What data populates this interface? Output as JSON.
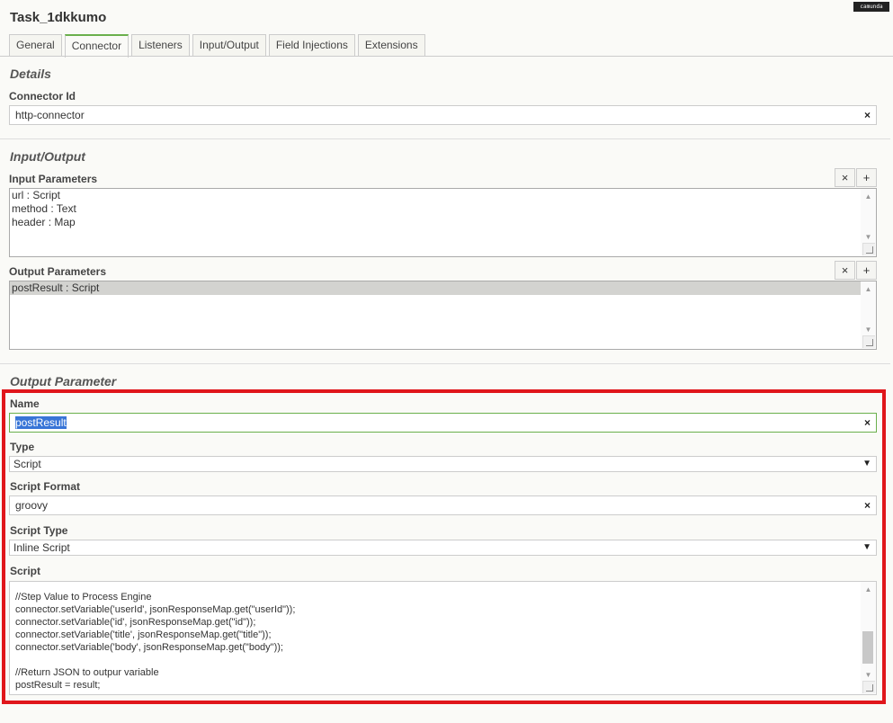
{
  "window_title": "Task_1dkkumo",
  "logo_text": "camunda",
  "tabs": [
    "General",
    "Connector",
    "Listeners",
    "Input/Output",
    "Field Injections",
    "Extensions"
  ],
  "details": {
    "heading": "Details",
    "connector_id_label": "Connector Id",
    "connector_id_value": "http-connector"
  },
  "io": {
    "heading": "Input/Output",
    "input_label": "Input Parameters",
    "input_items": [
      "url : Script",
      "method : Text",
      "header : Map"
    ],
    "output_label": "Output Parameters",
    "output_items": [
      "postResult : Script"
    ]
  },
  "output_param": {
    "heading": "Output Parameter",
    "name_label": "Name",
    "name_value": "postResult",
    "type_label": "Type",
    "type_value": "Script",
    "format_label": "Script Format",
    "format_value": "groovy",
    "script_type_label": "Script Type",
    "script_type_value": "Inline Script",
    "script_label": "Script",
    "script_lines": [
      "//Step Value to Process Engine",
      "connector.setVariable('userId', jsonResponseMap.get(\"userId\"));",
      "connector.setVariable('id', jsonResponseMap.get(\"id\"));",
      "connector.setVariable('title', jsonResponseMap.get(\"title\"));",
      "connector.setVariable('body', jsonResponseMap.get(\"body\"));",
      "",
      "//Return JSON to outpur variable",
      "postResult = result;"
    ]
  },
  "icons": {
    "clear": "×",
    "add": "+",
    "dropdown": "▼"
  },
  "colors": {
    "highlight_border": "#e0161b",
    "active_tab": "#6ab04c",
    "selection": "#3875d7"
  }
}
